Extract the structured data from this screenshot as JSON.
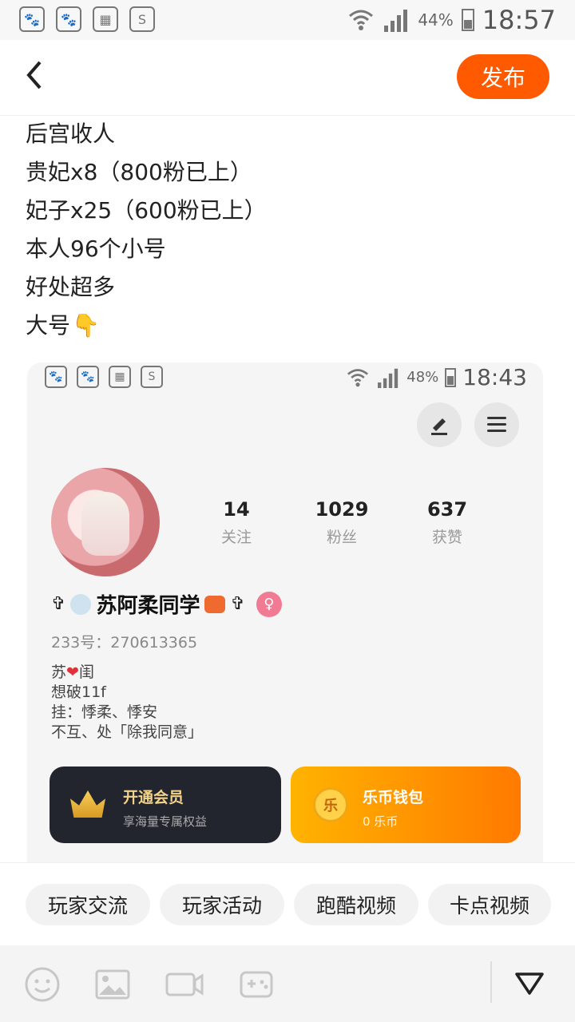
{
  "status_bar": {
    "icons_left": [
      "baidu-paw-icon",
      "baidu-paw-icon",
      "gallery-icon",
      "s-app-icon"
    ],
    "battery_pct": "44%",
    "time": "18:57"
  },
  "header": {
    "back_icon": "chevron-left-icon",
    "publish_label": "发布",
    "accent_color": "#ff5a00"
  },
  "post": {
    "lines": [
      "后宫收人",
      "贵妃x8（800粉已上）",
      "妃子x25（600粉已上）",
      "本人96个小号",
      "好处超多",
      "大号"
    ]
  },
  "screenshot": {
    "status_bar": {
      "battery_pct": "48%",
      "time": "18:43"
    },
    "stats": [
      {
        "value": "14",
        "label": "关注"
      },
      {
        "value": "1029",
        "label": "粉丝"
      },
      {
        "value": "637",
        "label": "获赞"
      }
    ],
    "nickname": "苏阿柔同学",
    "gender_symbol": "♀",
    "uid": "233号：270613365",
    "bio": [
      "苏",
      "闺",
      "想破11f",
      "挂：悸柔、悸安",
      "不互、处「除我同意」"
    ],
    "vip": {
      "title": "开通会员",
      "subtitle": "享海量专属权益"
    },
    "wallet": {
      "title": "乐币钱包",
      "subtitle": "0 乐币",
      "coin_char": "乐"
    }
  },
  "topics": [
    "玩家交流",
    "玩家活动",
    "跑酷视频",
    "卡点视频"
  ],
  "toolbar": {
    "icons": [
      "emoji-icon",
      "image-icon",
      "video-icon",
      "gamepad-icon"
    ],
    "collapse_icon": "triangle-down-icon"
  }
}
